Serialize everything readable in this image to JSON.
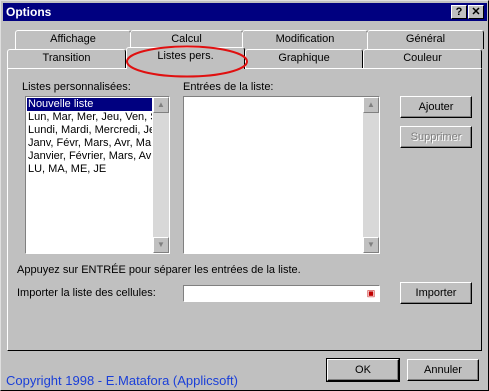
{
  "window": {
    "title": "Options",
    "help_button": "?",
    "close_button": "✕"
  },
  "tabs_row1": [
    "Affichage",
    "Calcul",
    "Modification",
    "Général"
  ],
  "tabs_row2": [
    "Transition",
    "Listes pers.",
    "Graphique",
    "Couleur"
  ],
  "active_tab": "Listes pers.",
  "panel": {
    "lists_label": "Listes personnalisées:",
    "entries_label": "Entrées de la liste:",
    "lists": [
      "Nouvelle liste",
      "Lun, Mar, Mer, Jeu, Ven, S",
      "Lundi, Mardi, Mercredi, Jeu",
      "Janv, Févr, Mars, Avr, Ma",
      "Janvier, Février, Mars, Av",
      "LU, MA, ME, JE"
    ],
    "selected_index": 0,
    "add_button": "Ajouter",
    "delete_button": "Supprimer",
    "hint_text": "Appuyez sur ENTRÉE pour séparer les entrées de la liste.",
    "import_label": "Importer la liste des cellules:",
    "import_value": "",
    "import_button": "Importer"
  },
  "footer": {
    "ok_button": "OK",
    "cancel_button": "Annuler"
  },
  "copyright": "Copyright 1998 - E.Matafora (Applicsoft)",
  "colors": {
    "titlebar": "#000080",
    "face": "#c0c0c0",
    "highlight_ellipse": "#e01010",
    "copyright": "#1a3fd8"
  }
}
